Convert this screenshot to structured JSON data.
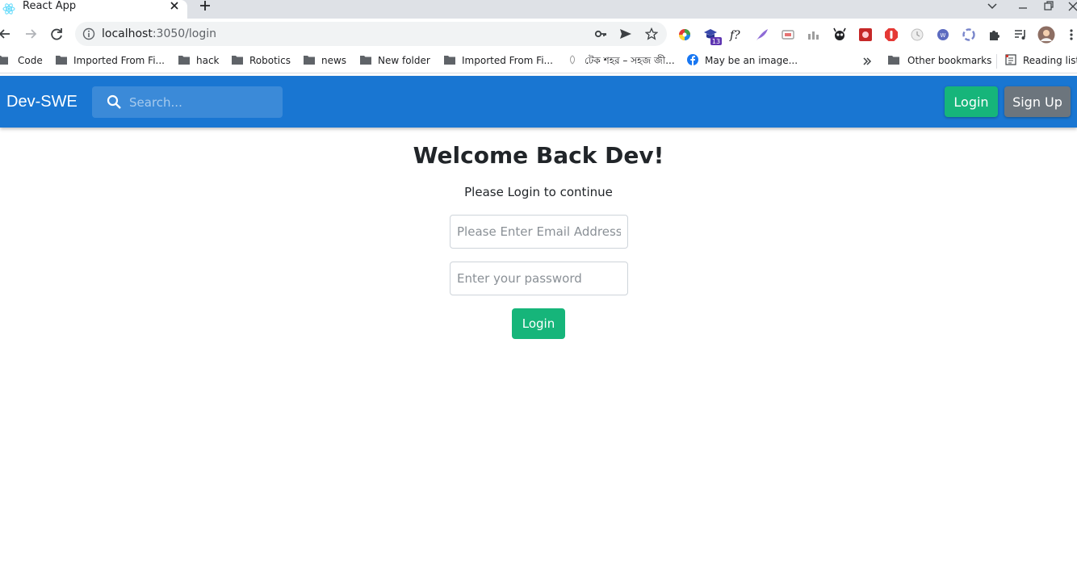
{
  "browser": {
    "tab_title": "React App",
    "url_host": "localhost",
    "url_rest": ":3050/login",
    "extension_badge": "13",
    "bookmarks": [
      {
        "label": "Code",
        "icon": "folder-icon"
      },
      {
        "label": "Imported From Fi...",
        "icon": "folder-icon"
      },
      {
        "label": "hack",
        "icon": "folder-icon"
      },
      {
        "label": "Robotics",
        "icon": "folder-icon"
      },
      {
        "label": "news",
        "icon": "folder-icon"
      },
      {
        "label": "New folder",
        "icon": "folder-icon"
      },
      {
        "label": "Imported From Fi...",
        "icon": "folder-icon"
      },
      {
        "label": "টেক শহর – সহজ জী...",
        "icon": "site-icon"
      },
      {
        "label": "May be an image...",
        "icon": "facebook-icon"
      }
    ],
    "other_bookmarks": "Other bookmarks",
    "reading_list": "Reading list"
  },
  "app": {
    "brand": "Dev-SWE",
    "search_placeholder": "Search...",
    "nav_login": "Login",
    "nav_signup": "Sign Up",
    "colors": {
      "navbar": "#1976d2",
      "success": "#16b57a",
      "secondary": "#6c757d"
    }
  },
  "login": {
    "heading": "Welcome Back Dev!",
    "subheading": "Please Login to continue",
    "email_placeholder": "Please Enter Email Address",
    "password_placeholder": "Enter your password",
    "submit_label": "Login"
  }
}
